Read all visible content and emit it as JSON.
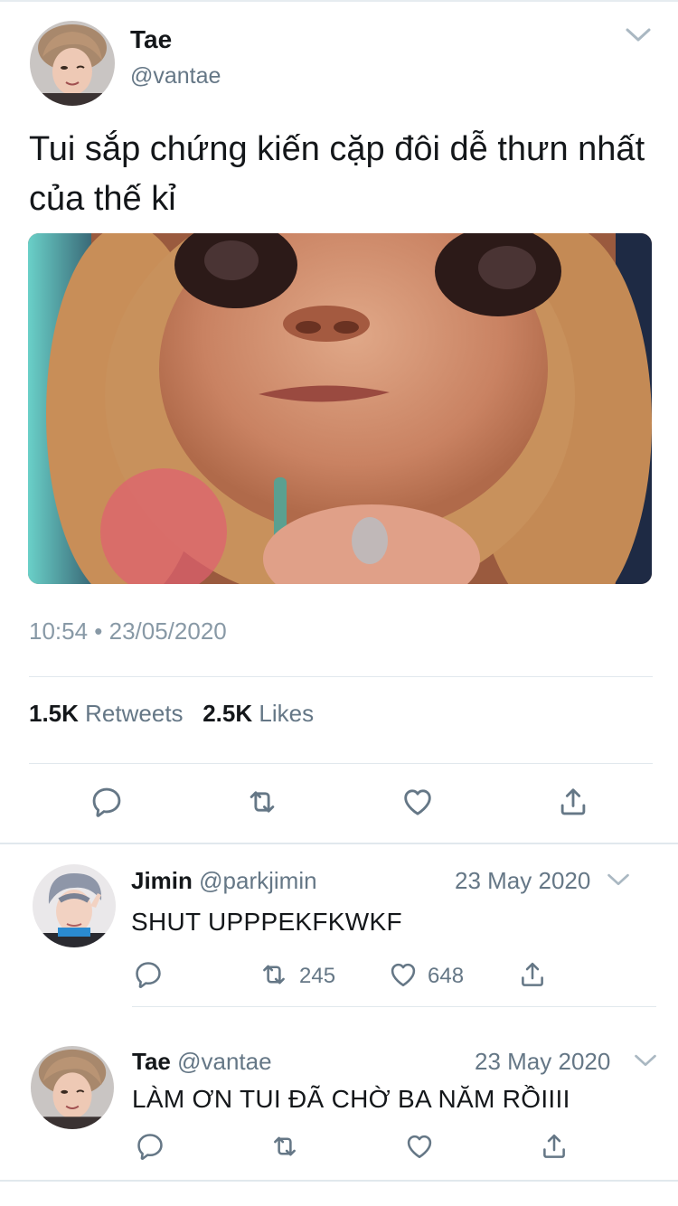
{
  "main_tweet": {
    "name": "Tae",
    "handle": "@vantae",
    "text": "Tui sắp chứng kiến cặp đôi dễ thưn nhất của thế kỉ",
    "timestamp": "10:54 • 23/05/2020",
    "retweets_count": "1.5K",
    "retweets_label": "Retweets",
    "likes_count": "2.5K",
    "likes_label": "Likes",
    "media_icon": "meme-photo"
  },
  "replies": [
    {
      "name": "Jimin",
      "handle": "@parkjimin",
      "date": "23 May 2020",
      "text": "SHUT UPPPEKFKWKF",
      "retweets": "245",
      "likes": "648"
    },
    {
      "name": "Tae",
      "handle": "@vantae",
      "date": "23 May 2020",
      "text": "LÀM ƠN TUI ĐÃ CHỜ BA NĂM RỒIIII"
    }
  ],
  "icons": {
    "reply": "reply-icon",
    "retweet": "retweet-icon",
    "like": "heart-icon",
    "share": "share-icon",
    "more": "chevron-down-icon"
  },
  "colors": {
    "text": "#14171a",
    "secondary": "#657786",
    "divider": "#e1e8ed"
  }
}
